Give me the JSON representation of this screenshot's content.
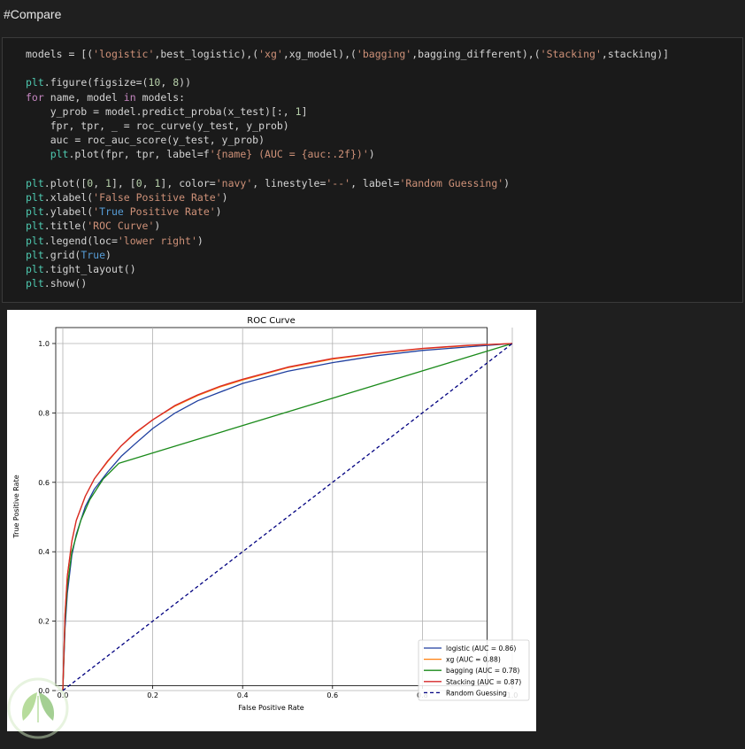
{
  "markdown": {
    "heading": "#Compare"
  },
  "code": {
    "lines": [
      "models = [('logistic',best_logistic),('xg',xg_model),('bagging',bagging_different),('Stacking',stacking)]",
      "",
      "plt.figure(figsize=(10, 8))",
      "for name, model in models:",
      "    y_prob = model.predict_proba(x_test)[:, 1]",
      "    fpr, tpr, _ = roc_curve(y_test, y_prob)",
      "    auc = roc_auc_score(y_test, y_prob)",
      "    plt.plot(fpr, tpr, label=f'{name} (AUC = {auc:.2f})')",
      "",
      "plt.plot([0, 1], [0, 1], color='navy', linestyle='--', label='Random Guessing')",
      "plt.xlabel('False Positive Rate')",
      "plt.ylabel('True Positive Rate')",
      "plt.title('ROC Curve')",
      "plt.legend(loc='lower right')",
      "plt.grid(True)",
      "plt.tight_layout()",
      "plt.show()"
    ]
  },
  "chart_data": {
    "type": "line",
    "title": "ROC Curve",
    "xlabel": "False Positive Rate",
    "ylabel": "True Positive Rate",
    "xlim": [
      0,
      1
    ],
    "ylim": [
      0,
      1
    ],
    "xticks": [
      "0.0",
      "0.2",
      "0.4",
      "0.6",
      "0.8",
      "1.0"
    ],
    "yticks": [
      "0.0",
      "0.2",
      "0.4",
      "0.6",
      "0.8",
      "1.0"
    ],
    "grid": true,
    "legend_position": "lower right",
    "series": [
      {
        "name": "logistic (AUC = 0.86)",
        "color": "#1f3f9f",
        "dash": false,
        "x": [
          0,
          0.005,
          0.01,
          0.02,
          0.03,
          0.05,
          0.07,
          0.1,
          0.13,
          0.16,
          0.2,
          0.25,
          0.3,
          0.35,
          0.4,
          0.5,
          0.6,
          0.7,
          0.8,
          0.9,
          1
        ],
        "y": [
          0,
          0.18,
          0.28,
          0.39,
          0.45,
          0.53,
          0.58,
          0.63,
          0.675,
          0.71,
          0.755,
          0.8,
          0.835,
          0.86,
          0.885,
          0.92,
          0.945,
          0.965,
          0.98,
          0.99,
          1
        ]
      },
      {
        "name": "xg (AUC = 0.88)",
        "color": "#ff7f0e",
        "dash": false,
        "x": [
          0,
          0.005,
          0.01,
          0.02,
          0.03,
          0.05,
          0.07,
          0.1,
          0.13,
          0.16,
          0.2,
          0.25,
          0.3,
          0.35,
          0.4,
          0.5,
          0.6,
          0.7,
          0.8,
          0.9,
          1
        ],
        "y": [
          0,
          0.22,
          0.33,
          0.43,
          0.49,
          0.56,
          0.61,
          0.66,
          0.705,
          0.74,
          0.78,
          0.82,
          0.85,
          0.875,
          0.895,
          0.93,
          0.955,
          0.972,
          0.985,
          0.994,
          1
        ]
      },
      {
        "name": "bagging (AUC = 0.78)",
        "color": "#1a8a1a",
        "dash": false,
        "x": [
          0,
          0.005,
          0.01,
          0.02,
          0.04,
          0.06,
          0.09,
          0.125,
          1
        ],
        "y": [
          0,
          0.2,
          0.3,
          0.4,
          0.49,
          0.55,
          0.61,
          0.655,
          1
        ]
      },
      {
        "name": "Stacking (AUC = 0.87)",
        "color": "#d62728",
        "dash": false,
        "x": [
          0,
          0.005,
          0.01,
          0.02,
          0.03,
          0.05,
          0.07,
          0.1,
          0.13,
          0.16,
          0.2,
          0.25,
          0.3,
          0.35,
          0.4,
          0.5,
          0.6,
          0.7,
          0.8,
          0.9,
          1
        ],
        "y": [
          0,
          0.22,
          0.33,
          0.43,
          0.49,
          0.56,
          0.61,
          0.662,
          0.705,
          0.742,
          0.78,
          0.822,
          0.852,
          0.877,
          0.897,
          0.932,
          0.957,
          0.973,
          0.986,
          0.995,
          1
        ]
      },
      {
        "name": "Random Guessing",
        "color": "#000080",
        "dash": true,
        "x": [
          0,
          1
        ],
        "y": [
          0,
          1
        ]
      }
    ]
  }
}
